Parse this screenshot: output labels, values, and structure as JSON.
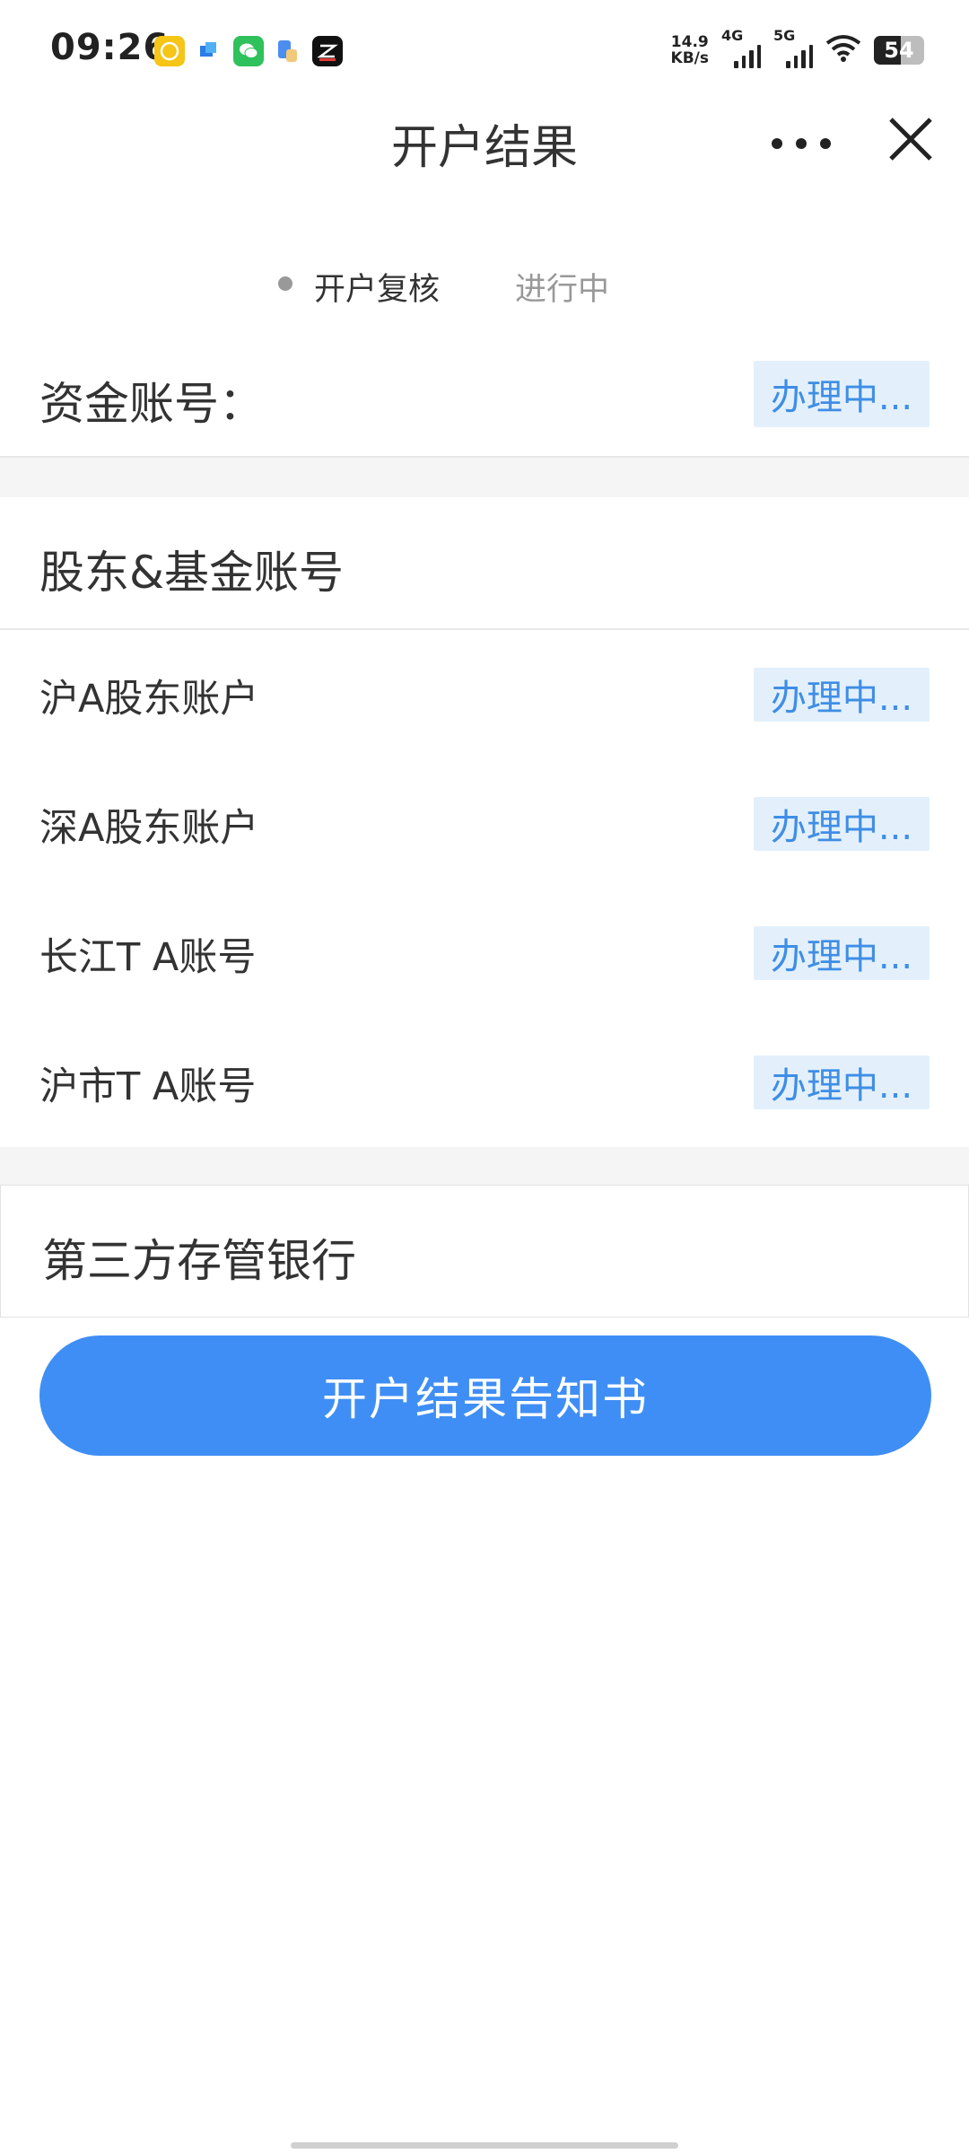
{
  "status_bar": {
    "time": "09:26",
    "net_speed_value": "14.9",
    "net_speed_unit": "KB/s",
    "signal_1_label": "4G",
    "signal_2_label": "5G",
    "battery": "54",
    "battery_level": 0.54
  },
  "nav": {
    "title": "开户结果"
  },
  "progress": {
    "step": "开户复核",
    "status": "进行中"
  },
  "fund_account": {
    "label": "资金账号：",
    "status": "办理中..."
  },
  "shareholder_section": {
    "title": "股东&基金账号",
    "items": [
      {
        "label": "沪A股东账户",
        "status": "办理中..."
      },
      {
        "label": "深A股东账户",
        "status": "办理中..."
      },
      {
        "label": "长江T A账号",
        "status": "办理中..."
      },
      {
        "label": "沪市T A账号",
        "status": "办理中..."
      }
    ]
  },
  "bank_section": {
    "title": "第三方存管银行"
  },
  "notice_button": {
    "label": "开户结果告知书"
  },
  "colors": {
    "accent": "#3f8ef5",
    "badge_bg": "#e3f0fc",
    "badge_text": "#3f8ee5"
  }
}
